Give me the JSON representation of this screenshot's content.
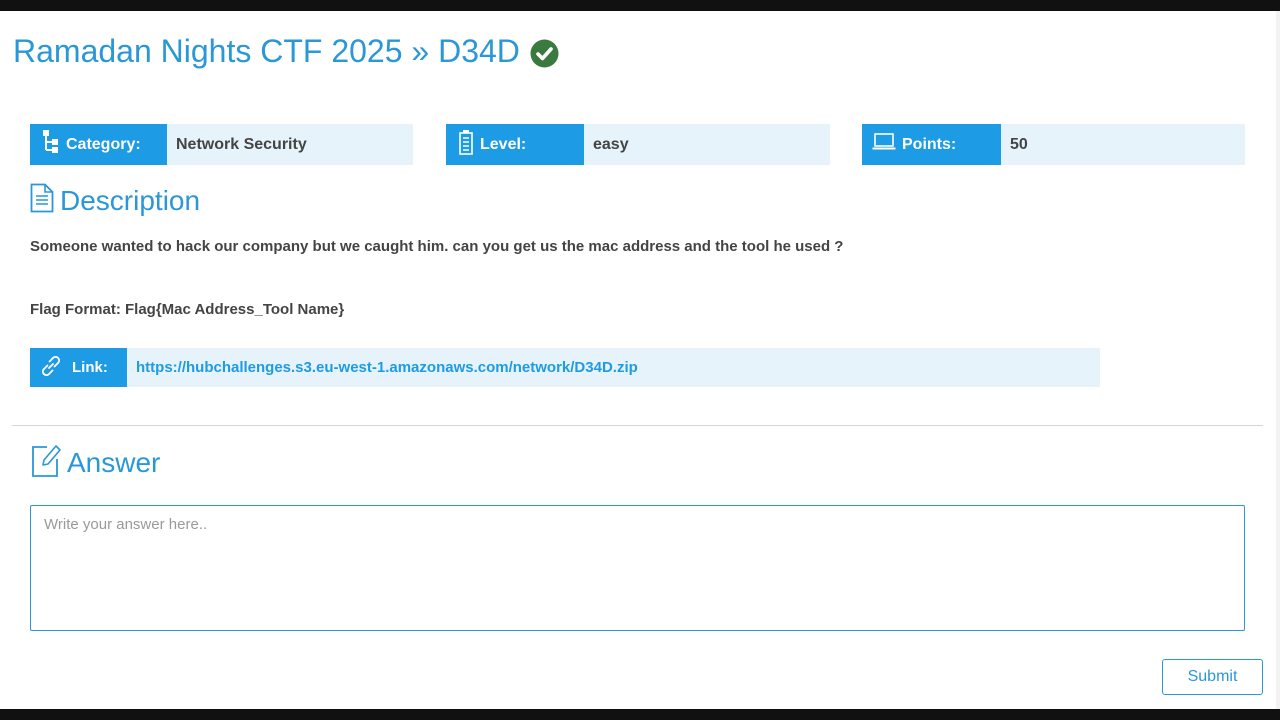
{
  "header": {
    "title": "Ramadan Nights CTF 2025 » D34D",
    "solved_icon": "check-circle-icon",
    "solved_color": "#3b7a3f"
  },
  "meta": {
    "category": {
      "label": "Category:",
      "value": "Network Security",
      "icon": "sitemap-icon"
    },
    "level": {
      "label": "Level:",
      "value": "easy",
      "icon": "battery-icon"
    },
    "points": {
      "label": "Points:",
      "value": "50",
      "icon": "laptop-icon"
    }
  },
  "description": {
    "heading": "Description",
    "icon": "document-icon",
    "text": "Someone wanted to hack our company but we caught him. can you get us the mac address and the tool he used ?",
    "flag_format": "Flag Format: Flag{Mac Address_Tool Name}"
  },
  "link": {
    "label": "Link:",
    "icon": "link-icon",
    "url": "https://hubchallenges.s3.eu-west-1.amazonaws.com/network/D34D.zip"
  },
  "answer": {
    "heading": "Answer",
    "icon": "edit-icon",
    "placeholder": "Write your answer here..",
    "submit_label": "Submit"
  },
  "colors": {
    "accent": "#1e9be5",
    "title": "#2a97d6",
    "label_bg": "#e6f3fb"
  }
}
